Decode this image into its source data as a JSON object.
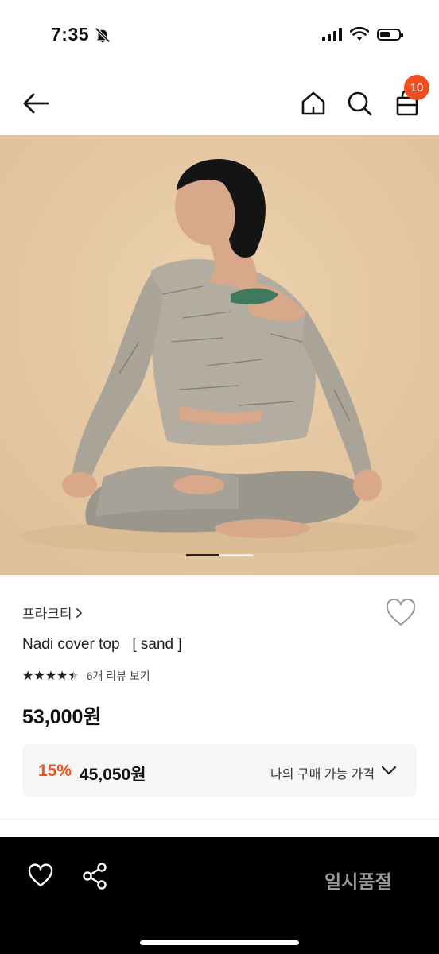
{
  "status_bar": {
    "time": "7:35"
  },
  "header": {
    "cart_count": "10"
  },
  "product": {
    "brand": "프라크티",
    "name": "Nadi cover top   [ sand ]",
    "review_link": "6개 리뷰 보기",
    "price": "53,000원",
    "rating": 4.5
  },
  "discount": {
    "percent": "15%",
    "price": "45,050원",
    "label": "나의 구매 가능 가격"
  },
  "bottom_bar": {
    "sold_out_label": "일시품절"
  },
  "colors": {
    "accent": "#f04e1c",
    "hero_bg": "#e6c9a4"
  },
  "carousel": {
    "current": 1,
    "total": 2
  }
}
